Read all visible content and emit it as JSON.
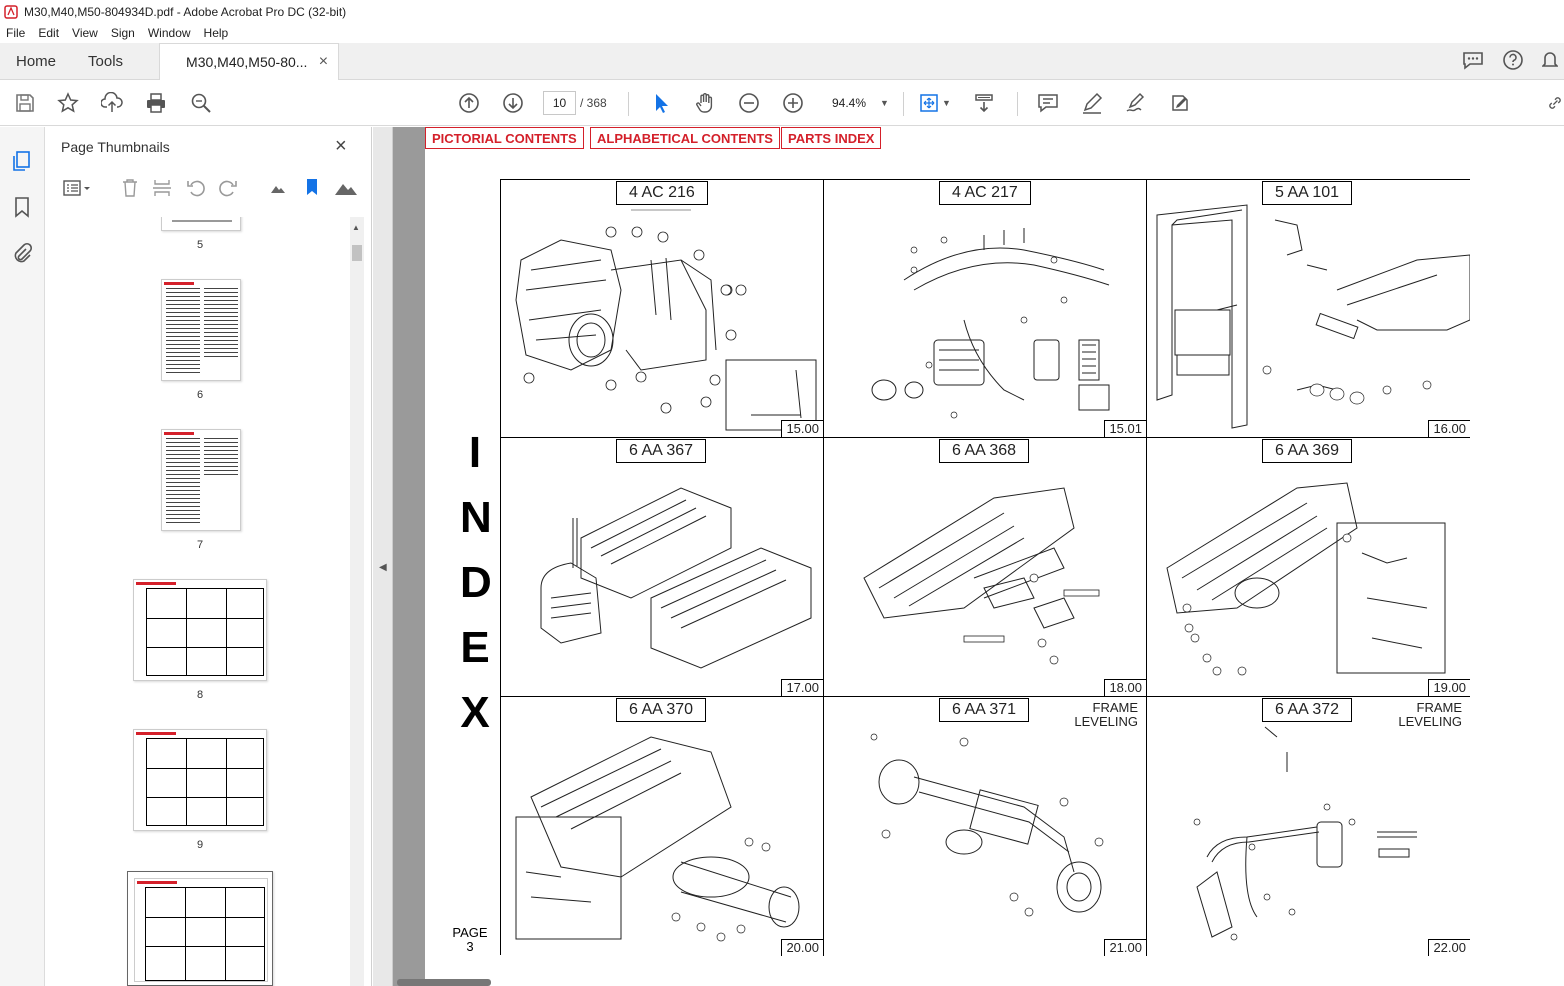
{
  "window": {
    "title": "M30,M40,M50-804934D.pdf - Adobe Acrobat Pro DC (32-bit)"
  },
  "menu": [
    "File",
    "Edit",
    "View",
    "Sign",
    "Window",
    "Help"
  ],
  "tabs": {
    "home": "Home",
    "tools": "Tools",
    "document": "M30,M40,M50-80...",
    "close": "×"
  },
  "toolbar": {
    "current_page": "10",
    "total_pages": "/  368",
    "zoom": "94.4%"
  },
  "panel": {
    "title": "Page Thumbnails",
    "close": "×",
    "thumbnail_labels": [
      "5",
      "6",
      "7",
      "8",
      "9"
    ]
  },
  "doc": {
    "nav_links": [
      "PICTORIAL CONTENTS",
      "ALPHABETICAL CONTENTS",
      "PARTS INDEX"
    ],
    "index_letters": [
      "I",
      "N",
      "D",
      "E",
      "X"
    ],
    "page_label": "PAGE",
    "page_number": "3",
    "cells": [
      {
        "code": "4 AC 216",
        "page": "15.00",
        "side": ""
      },
      {
        "code": "4 AC 217",
        "page": "15.01",
        "side": ""
      },
      {
        "code": "5 AA 101",
        "page": "16.00",
        "side": ""
      },
      {
        "code": "6 AA 367",
        "page": "17.00",
        "side": ""
      },
      {
        "code": "6 AA 368",
        "page": "18.00",
        "side": ""
      },
      {
        "code": "6 AA 369",
        "page": "19.00",
        "side": ""
      },
      {
        "code": "6 AA 370",
        "page": "20.00",
        "side": ""
      },
      {
        "code": "6 AA 371",
        "page": "21.00",
        "side": "FRAME\nLEVELING"
      },
      {
        "code": "6 AA 372",
        "page": "22.00",
        "side": "FRAME\nLEVELING"
      }
    ]
  },
  "colors": {
    "accent_red": "#d4202a",
    "doc_background": "#9a9a9a",
    "icon_blue": "#1473e6"
  },
  "icons": [
    "save-icon",
    "bookmark-star-icon",
    "upload-icon",
    "print-icon",
    "zoom-search-icon",
    "prev-page-icon",
    "next-page-icon",
    "select-cursor-icon",
    "hand-icon",
    "zoom-out-icon",
    "zoom-in-icon",
    "fit-page-icon",
    "scroll-mode-icon",
    "comment-icon",
    "pen-icon",
    "sign-icon",
    "share-tool-icon"
  ]
}
